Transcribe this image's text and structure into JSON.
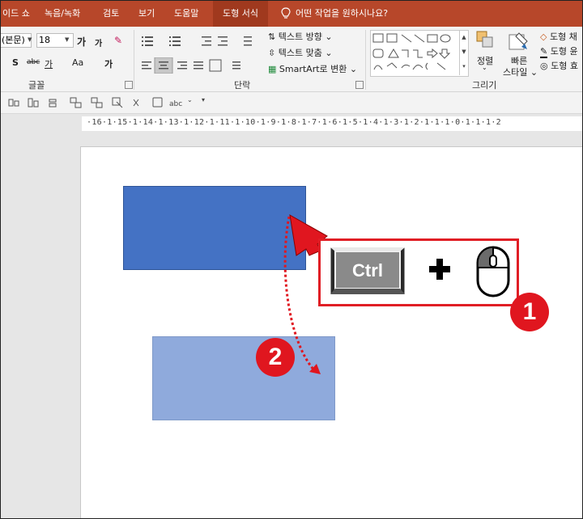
{
  "tabs": [
    {
      "label": "이드 쇼"
    },
    {
      "label": "녹음/녹화"
    },
    {
      "label": "검토"
    },
    {
      "label": "보기"
    },
    {
      "label": "도움말"
    },
    {
      "label": "도형 서식"
    }
  ],
  "tell_me": "어떤 작업을 원하시나요?",
  "font": {
    "name": "(본문)",
    "size": "18"
  },
  "ribbon": {
    "group_font": "글꼴",
    "group_paragraph": "단락",
    "group_drawing": "그리기",
    "text_direction": "텍스트 방향",
    "align_text": "텍스트 맞춤",
    "smartart": "SmartArt로 변환",
    "arrange": "정렬",
    "quick_styles_1": "빠른",
    "quick_styles_2": "스타일",
    "shape_fill": "도형 채",
    "shape_outline": "도형 윤",
    "shape_effects": "도형 효",
    "grow_font": "가",
    "shrink_font": "가",
    "strike": "abc",
    "spacing": "가",
    "aa": "Aa",
    "case": "가",
    "bold_s": "S",
    "abc_q": "abc"
  },
  "ruler": "·16·1·15·1·14·1·13·1·12·1·11·1·10·1·9·1·8·1·7·1·6·1·5·1·4·1·3·1·2·1·1·1·0·1·1·1·2",
  "callout": {
    "key_label": "Ctrl"
  },
  "badges": {
    "one": "1",
    "two": "2"
  },
  "colors": {
    "accent_red": "#e0161f",
    "shape_blue": "#4472c4",
    "shape_light": "#8faadc",
    "tab_bar": "#b7472a"
  }
}
